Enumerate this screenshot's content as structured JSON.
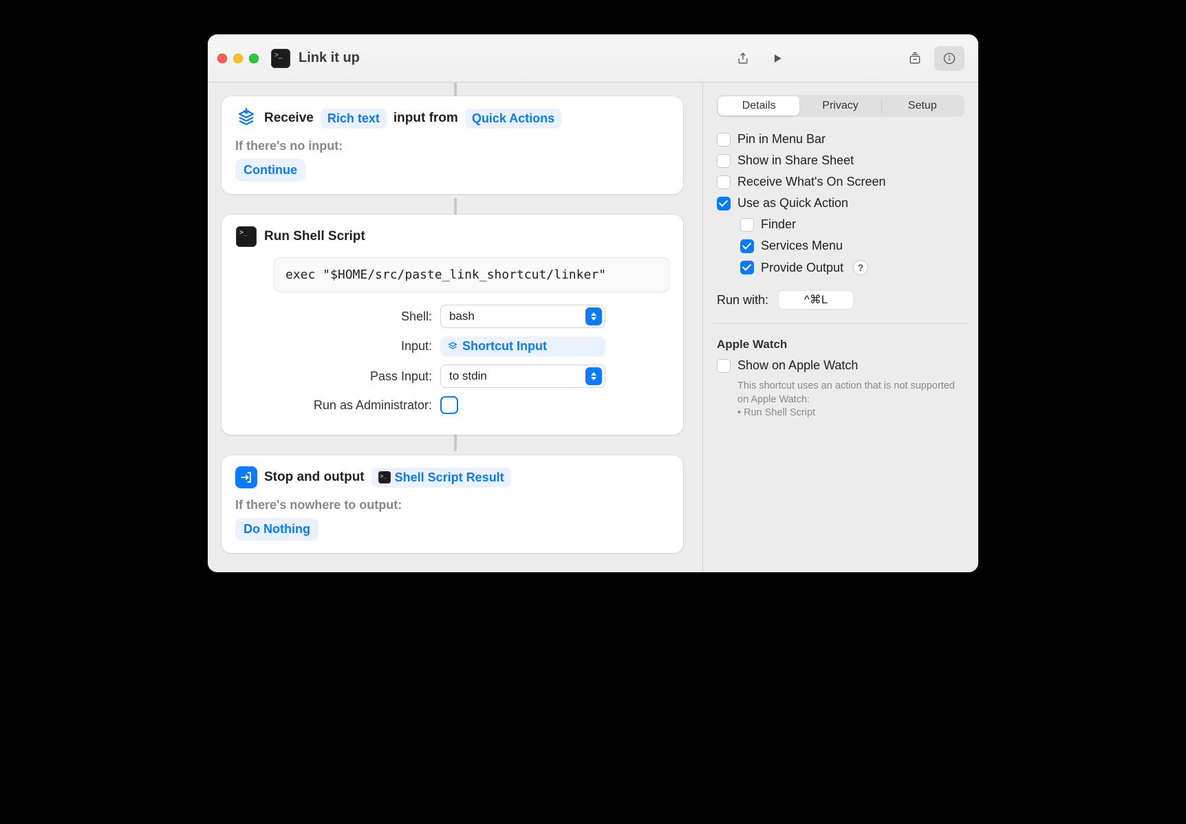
{
  "window": {
    "title": "Link it up"
  },
  "canvas": {
    "receive": {
      "word_receive": "Receive",
      "type_token": "Rich text",
      "word_input_from": "input from",
      "source_token": "Quick Actions",
      "no_input_label": "If there's no input:",
      "no_input_action": "Continue"
    },
    "script": {
      "title": "Run Shell Script",
      "code": "exec \"$HOME/src/paste_link_shortcut/linker\"",
      "shell_label": "Shell:",
      "shell_value": "bash",
      "input_label": "Input:",
      "input_value": "Shortcut Input",
      "pass_label": "Pass Input:",
      "pass_value": "to stdin",
      "admin_label": "Run as Administrator:",
      "admin_checked": false
    },
    "output": {
      "word_stop": "Stop and output",
      "result_token": "Shell Script Result",
      "nowhere_label": "If there's nowhere to output:",
      "nowhere_action": "Do Nothing"
    }
  },
  "sidebar": {
    "tabs": {
      "details": "Details",
      "privacy": "Privacy",
      "setup": "Setup",
      "selected": "details"
    },
    "pin_label": "Pin in Menu Bar",
    "pin_checked": false,
    "share_label": "Show in Share Sheet",
    "share_checked": false,
    "receive_label": "Receive What's On Screen",
    "receive_checked": false,
    "quick_label": "Use as Quick Action",
    "quick_checked": true,
    "finder_label": "Finder",
    "finder_checked": false,
    "services_label": "Services Menu",
    "services_checked": true,
    "provide_label": "Provide Output",
    "provide_checked": true,
    "runwith_label": "Run with:",
    "runwith_value": "^⌘L",
    "watch_heading": "Apple Watch",
    "watch_show_label": "Show on Apple Watch",
    "watch_show_checked": false,
    "watch_note_line1": "This shortcut uses an action that is not supported on Apple Watch:",
    "watch_note_line2": "• Run Shell Script"
  }
}
